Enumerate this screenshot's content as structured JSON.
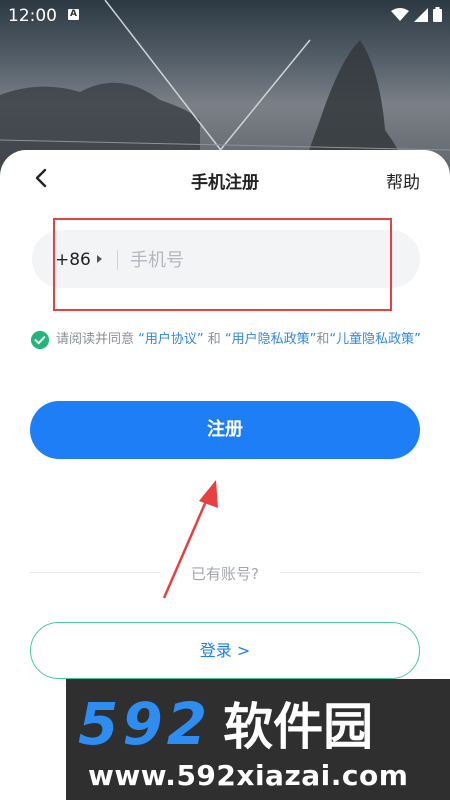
{
  "status_bar": {
    "time": "12:00",
    "notification_badge": "A",
    "icons": [
      "wifi-icon",
      "signal-icon",
      "battery-icon"
    ]
  },
  "header": {
    "title": "手机注册",
    "help": "帮助"
  },
  "phone": {
    "country_code": "+86",
    "placeholder": "手机号",
    "value": ""
  },
  "agreement": {
    "prefix": "请阅读并同意 ",
    "user_agreement": "“用户协议”",
    "and1": " 和 ",
    "privacy_policy": "“用户隐私政策”",
    "and2": "和",
    "child_privacy": "“儿童隐私政策”",
    "checked": true
  },
  "register_button": "注册",
  "have_account": "已有账号?",
  "login_button": "登录 >",
  "watermark": {
    "digits": "592",
    "name": "软件园",
    "url": "www.592xiazai.com"
  },
  "colors": {
    "primary": "#1e7ef5",
    "link": "#2f87e6",
    "check": "#21b77a",
    "annotation": "#e84040",
    "login_border": "#48c9a3"
  }
}
